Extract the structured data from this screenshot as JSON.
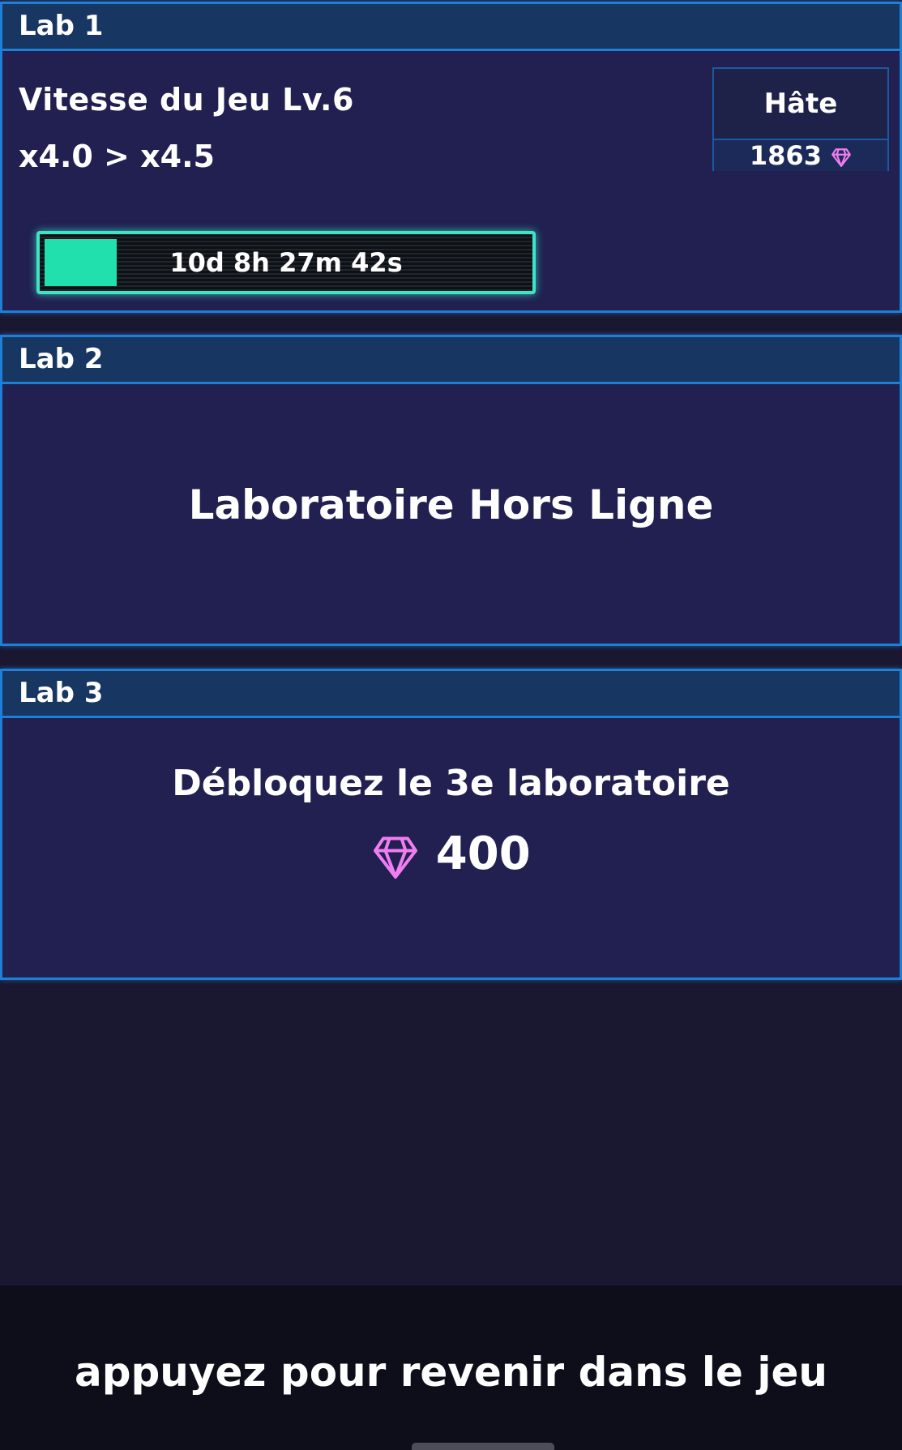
{
  "colors": {
    "background": "#1a1730",
    "panel": "#212050",
    "header": "#173762",
    "border": "#1d7fd6",
    "progress": "#22dfae",
    "gem": "#f17ef0"
  },
  "labs": [
    {
      "title": "Lab 1",
      "research_name": "Vitesse du Jeu Lv.6",
      "research_values": "x4.0 > x4.5",
      "haste_label": "Hâte",
      "haste_cost": "1863",
      "haste_cost_icon": "gem-icon",
      "timer": "10d 8h 27m 42s",
      "progress_fraction": 0.15
    },
    {
      "title": "Lab 2",
      "status": "Laboratoire Hors Ligne"
    },
    {
      "title": "Lab 3",
      "unlock_text": "Débloquez le 3e laboratoire",
      "unlock_cost": "400",
      "unlock_cost_icon": "gem-icon"
    }
  ],
  "footer": {
    "text": "appuyez pour revenir dans le jeu"
  }
}
